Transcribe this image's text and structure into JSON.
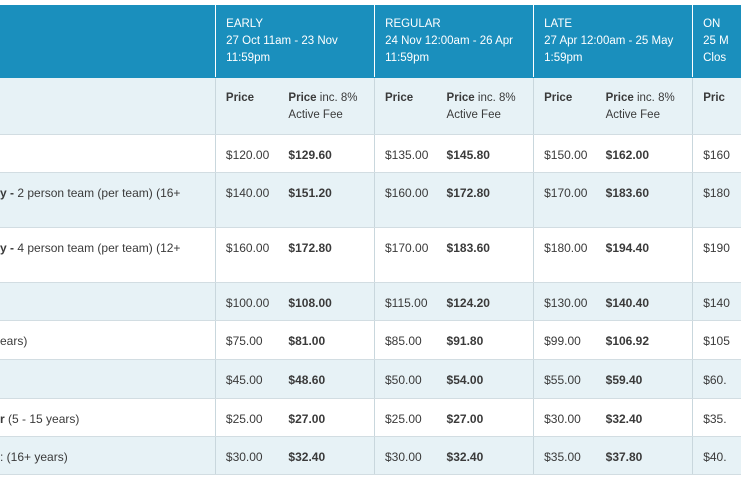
{
  "periods": [
    {
      "name": "EARLY",
      "line1": "27 Oct  11am - 23 Nov",
      "line2": "11:59pm"
    },
    {
      "name": "REGULAR",
      "line1": "24 Nov 12:00am - 26 Apr",
      "line2": "11:59pm"
    },
    {
      "name": "LATE",
      "line1": "27 Apr 12:00am - 25 May",
      "line2": "1:59pm"
    },
    {
      "name": "ON",
      "line1": "25 M",
      "line2": "Clos"
    }
  ],
  "subheaders": {
    "price": "Price",
    "price_inc_bold": "Price",
    "price_inc_rest": " inc. 8%",
    "price_inc_line2": "Active Fee",
    "price_partial": "Pric"
  },
  "rows": [
    {
      "desc_bold": "",
      "desc_rest": "",
      "desc_line2": "",
      "cells": [
        "$120.00",
        "$129.60",
        "$135.00",
        "$145.80",
        "$150.00",
        "$162.00",
        "$160"
      ]
    },
    {
      "desc_bold": "y -",
      "desc_rest": " 2 person team (per team) (16+",
      "desc_line2": "",
      "cells": [
        "$140.00",
        "$151.20",
        "$160.00",
        "$172.80",
        "$170.00",
        "$183.60",
        "$180"
      ]
    },
    {
      "desc_bold": "y -",
      "desc_rest": " 4 person team (per team) (12+",
      "desc_line2": "",
      "cells": [
        "$160.00",
        "$172.80",
        "$170.00",
        "$183.60",
        "$180.00",
        "$194.40",
        "$190"
      ]
    },
    {
      "desc_bold": "",
      "desc_rest": "",
      "desc_line2": "",
      "cells": [
        "$100.00",
        "$108.00",
        "$115.00",
        "$124.20",
        "$130.00",
        "$140.40",
        "$140"
      ]
    },
    {
      "desc_bold": "",
      "desc_rest": "ears)",
      "desc_line2": "",
      "cells": [
        "$75.00",
        "$81.00",
        "$85.00",
        "$91.80",
        "$99.00",
        "$106.92",
        "$105"
      ]
    },
    {
      "desc_bold": "",
      "desc_rest": "",
      "desc_line2": "",
      "cells": [
        "$45.00",
        "$48.60",
        "$50.00",
        "$54.00",
        "$55.00",
        "$59.40",
        "$60."
      ]
    },
    {
      "desc_bold": "r",
      "desc_rest": " (5 - 15 years)",
      "desc_line2": "",
      "cells": [
        "$25.00",
        "$27.00",
        "$25.00",
        "$27.00",
        "$30.00",
        "$32.40",
        "$35."
      ]
    },
    {
      "desc_bold": "",
      "desc_rest": ": (16+ years)",
      "desc_line2": "",
      "cells": [
        "$30.00",
        "$32.40",
        "$30.00",
        "$32.40",
        "$35.00",
        "$37.80",
        "$40."
      ]
    }
  ]
}
